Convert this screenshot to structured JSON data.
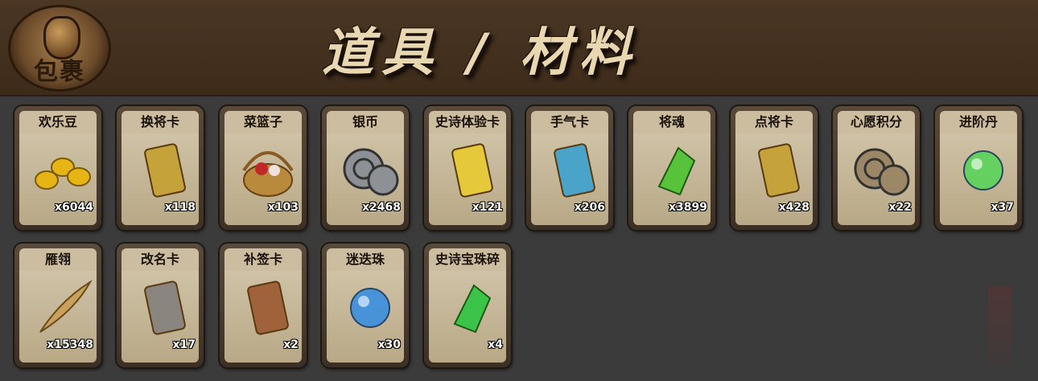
{
  "header": {
    "bag_label": "包裹",
    "title": "道具 / 材料"
  },
  "items": [
    {
      "name": "欢乐豆",
      "count": "x6044",
      "icon": "gold-beans-icon",
      "color": "#e7b416"
    },
    {
      "name": "换将卡",
      "count": "x118",
      "icon": "swap-general-card-icon",
      "color": "#c6a33a"
    },
    {
      "name": "菜篮子",
      "count": "x103",
      "icon": "vegetable-basket-icon",
      "color": "#b98a3c"
    },
    {
      "name": "银币",
      "count": "x2468",
      "icon": "silver-coins-icon",
      "color": "#8d9095"
    },
    {
      "name": "史诗体验卡",
      "count": "x121",
      "icon": "epic-trial-card-icon",
      "color": "#e6c93a"
    },
    {
      "name": "手气卡",
      "count": "x206",
      "icon": "luck-card-icon",
      "color": "#4aa3c9"
    },
    {
      "name": "将魂",
      "count": "x3899",
      "icon": "general-soul-crystal-icon",
      "color": "#58c23a"
    },
    {
      "name": "点将卡",
      "count": "x428",
      "icon": "pick-general-card-icon",
      "color": "#c6a33a"
    },
    {
      "name": "心愿积分",
      "count": "x22",
      "icon": "wish-points-coin-icon",
      "color": "#9c8866"
    },
    {
      "name": "进阶丹",
      "count": "x37",
      "icon": "advance-pill-icon",
      "color": "#5bd45a"
    },
    {
      "name": "雁翎",
      "count": "x15348",
      "icon": "feather-icon",
      "color": "#c9a15a"
    },
    {
      "name": "改名卡",
      "count": "x17",
      "icon": "rename-card-icon",
      "color": "#8b8580"
    },
    {
      "name": "补签卡",
      "count": "x2",
      "icon": "makeup-sign-card-icon",
      "color": "#a0623a"
    },
    {
      "name": "迷迭珠",
      "count": "x30",
      "icon": "blue-orb-icon",
      "color": "#3b8fe0"
    },
    {
      "name": "史诗宝珠碎",
      "count": "x4",
      "icon": "epic-gem-shard-icon",
      "color": "#3cc44a"
    }
  ]
}
